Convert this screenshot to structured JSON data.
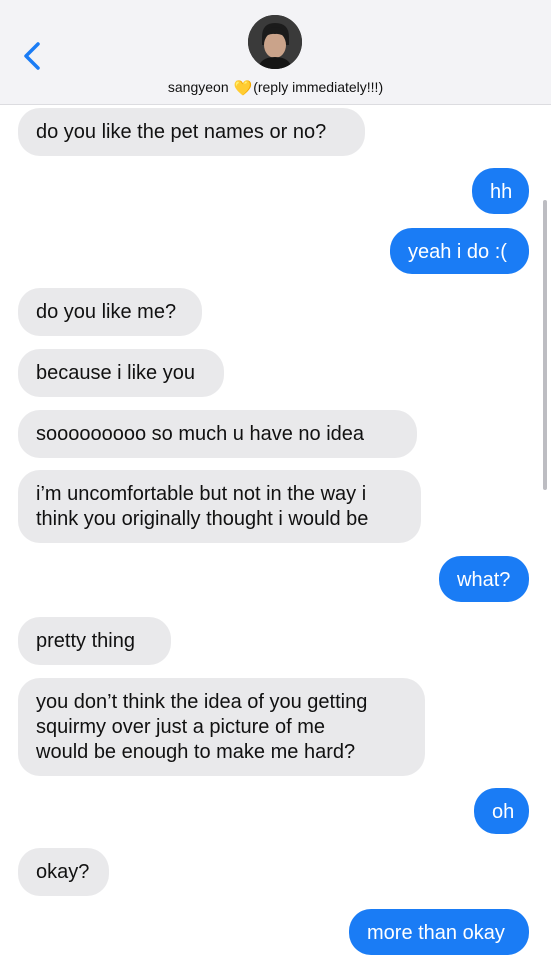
{
  "header": {
    "contact_name": "sangyeon",
    "status_note": "(reply immediately!!!)",
    "heart_glyph": "💛",
    "accent_color": "#1a7cf5"
  },
  "messages": [
    {
      "from": "them",
      "text": "do you like the pet names or no?"
    },
    {
      "from": "me",
      "text": "hh"
    },
    {
      "from": "me",
      "text": "yeah i do :("
    },
    {
      "from": "them",
      "text": "do you like me?"
    },
    {
      "from": "them",
      "text": "because i like you"
    },
    {
      "from": "them",
      "text": "sooooooooo so much u have no idea"
    },
    {
      "from": "them",
      "text": "i’m uncomfortable but not in the way i\nthink you originally thought i would be"
    },
    {
      "from": "me",
      "text": "what?"
    },
    {
      "from": "them",
      "text": "pretty thing"
    },
    {
      "from": "them",
      "text": "you don’t think the idea of you getting\nsquirmy over just a picture of me\nwould be enough to make me hard?"
    },
    {
      "from": "me",
      "text": "oh"
    },
    {
      "from": "them",
      "text": "okay?"
    },
    {
      "from": "me",
      "text": "more than okay"
    }
  ]
}
